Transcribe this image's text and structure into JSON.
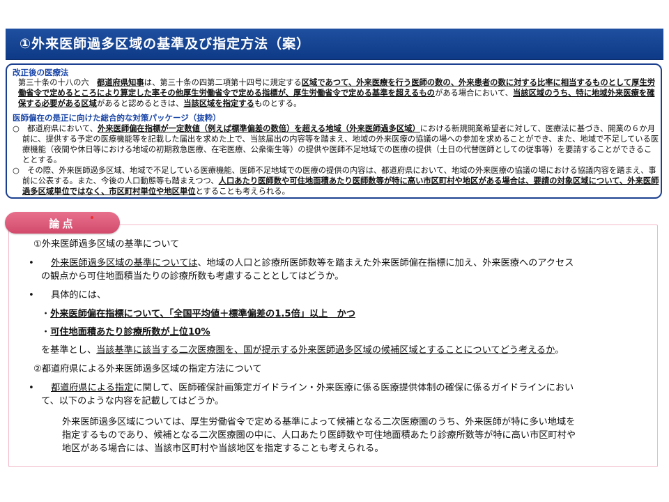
{
  "header": {
    "title": "①外来医師過多区域の基準及び指定方法（案）"
  },
  "law_box": {
    "heading_1": "改正後の医療法",
    "article_prefix": "第三十条の十八の六　",
    "article_p1": "都道府県知事",
    "article_p2": "は、第三十条の四第二項第十四号に規定する",
    "article_p3": "区域であつて、外来医療を行う医師の数の、外来患者の数に対する比率に相当するものとして厚生労働省令で定めるところにより算定した率その他厚生労働省令で定める指標が、厚生労働省令で定める基準を超えるもの",
    "article_p4": "がある場合において、",
    "article_p5": "当該区域のうち、特に地域外来医療を確保する必要がある区域",
    "article_p6": "があると認めるときは、",
    "article_p7": "当該区域を指定する",
    "article_p8": "ものとする。",
    "heading_2": "医師偏在の是正に向けた総合的な対策パッケージ（抜粋）",
    "b1_mark": "○",
    "b1_p1": "　都道府県において、",
    "b1_p2": "外来医師偏在指標が一定数値（例えば標準偏差の数倍）を超える地域（外来医師過多区域）",
    "b1_p3": "における新規開業希望者に対して、医療法に基づき、開業の６か月前に、提供する予定の医療機能等を記載した届出を求めた上で、当該届出の内容等を踏まえ、地域の外来医療の協議の場への参加を求めることができ、また、地域で不足している医療機能（夜間や休日等における地域の初期救急医療、在宅医療、公衆衛生等）の提供や医師不足地域での医療の提供（土日の代替医師としての従事等）を要請することができることとする。",
    "b2_mark": "○",
    "b2_p1": "　その際、外来医師過多区域、地域で不足している医療機能、医師不足地域での医療の提供の内容は、都道府県において、地域の外来医療の協議の場における協議内容を踏まえ、事前に公表する。また、今後の人口動態等も踏まえつつ、",
    "b2_p2": "人口あたり医師数や可住地面積あたり医師数等が特に高い市区町村や地区がある場合は、要請の対象区域について、外来医師過多区域単位ではなく、市区町村単位や地区単位",
    "b2_p3": "とすることも考えられる。"
  },
  "issues": {
    "tab_label": "論点",
    "s1_heading": "①外来医師過多区域の基準について",
    "s1_b1_mark": "•",
    "s1_b1_u": "外来医師過多区域の基準については",
    "s1_b1_rest1": "、地域の人口と診療所医師数等を踏まえた外来医師偏在指標に加え、外来医療へのアクセス",
    "s1_b1_rest2": "の観点から可住地面積当たりの診療所数も考慮することとしてはどうか。",
    "s1_b2_mark": "•",
    "s1_b2_text": "具体的には、",
    "crit_1_dot": "・",
    "crit_1": "外来医師偏在指標について、「全国平均値＋標準偏差の1.5倍」以上　かつ",
    "crit_2_dot": "・",
    "crit_2": "可住地面積あたり診療所数が上位10%",
    "s1_concl_pre": "を基準とし、",
    "s1_concl_u": "当該基準に該当する二次医療圏を、国が提示する外来医師過多区域の候補区域とすることについてどう考えるか",
    "s1_concl_end": "。",
    "s2_heading": "②都道府県による外来医師過多区域の指定方法について",
    "s2_b1_mark": "•",
    "s2_b1_u": "都道府県による指定",
    "s2_b1_rest1": "に関して、医師確保計画策定ガイドライン・外来医療に係る医療提供体制の確保に係るガイドラインにおい",
    "s2_b1_rest2": "て、以下のような内容を記載してはどうか。",
    "s2_q1": "外来医師過多区域については、厚生労働省令で定める基準によって候補となる二次医療圏のうち、外来医師が特に多い地域を",
    "s2_q2": "指定するものであり、候補となる二次医療圏の中に、人口あたり医師数や可住地面積あたり診療所数等が特に高い市区町村や",
    "s2_q3": "地区がある場合には、当該市区町村や当該地区を指定することも考えられる。"
  }
}
